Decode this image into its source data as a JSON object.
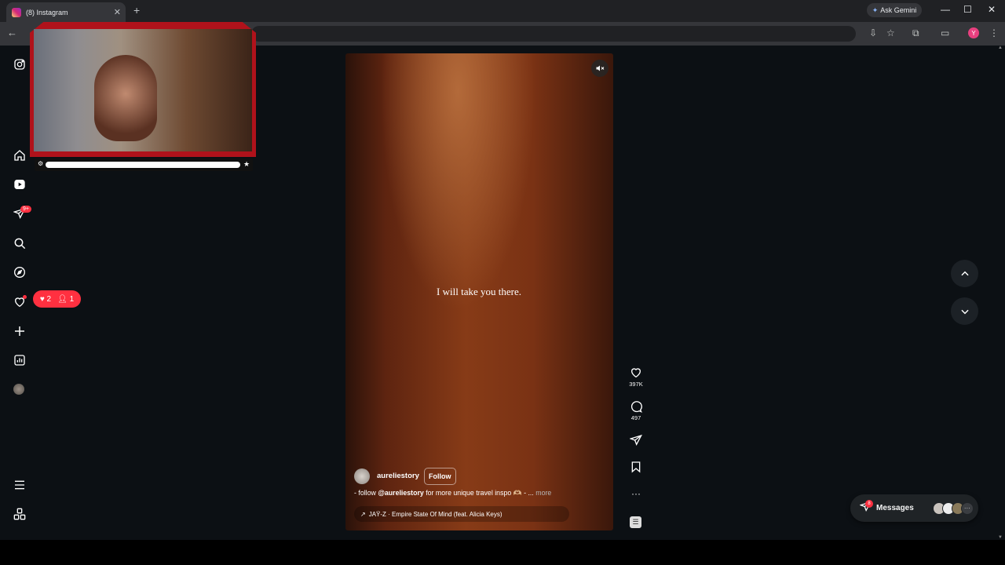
{
  "browser": {
    "tab_title": "(8) Instagram",
    "new_tab": "+",
    "ask_gemini": "Ask Gemini",
    "profile_initial": "Y"
  },
  "sidebar": {
    "notifications_badge": "9+",
    "activity": {
      "likes": "2",
      "follows": "1"
    }
  },
  "reel": {
    "overlay_text": "I will take you there.",
    "author": "aureliestory",
    "follow_label": "Follow",
    "description_prefix": "- follow ",
    "description_mention": "@aureliestory",
    "description_suffix": " for more unique travel inspo 🫶🏼 - ...",
    "more_label": "more",
    "audio": "JAŸ-Z · Empire State Of Mind (feat. Alicia Keys)",
    "likes": "397K",
    "comments": "497"
  },
  "messages": {
    "label": "Messages",
    "badge": "8"
  },
  "colors": {
    "accent_red": "#ff3040",
    "background": "#0c1014"
  }
}
